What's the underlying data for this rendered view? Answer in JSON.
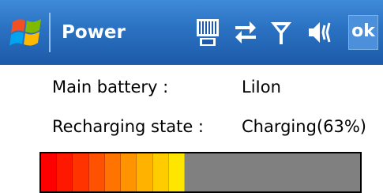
{
  "window": {
    "title": "Power",
    "start_icon": "windows-flag-icon",
    "tray_icons": [
      "battery-status-icon",
      "sync-arrows-icon",
      "signal-antenna-icon",
      "speaker-volume-icon"
    ],
    "ok_label": "ok"
  },
  "battery": {
    "main_label": "Main battery :",
    "main_value": "LiIon",
    "state_label": "Recharging state :",
    "state_value": "Charging(63%)",
    "level": 0.45
  },
  "colors": {
    "titlebar": "#2c73c4",
    "bar_background": "#808080",
    "gradient": [
      "#ff0000",
      "#ff1800",
      "#ff3300",
      "#ff5200",
      "#ff7300",
      "#ff9400",
      "#ffb200",
      "#ffcc00",
      "#ffe600"
    ]
  }
}
